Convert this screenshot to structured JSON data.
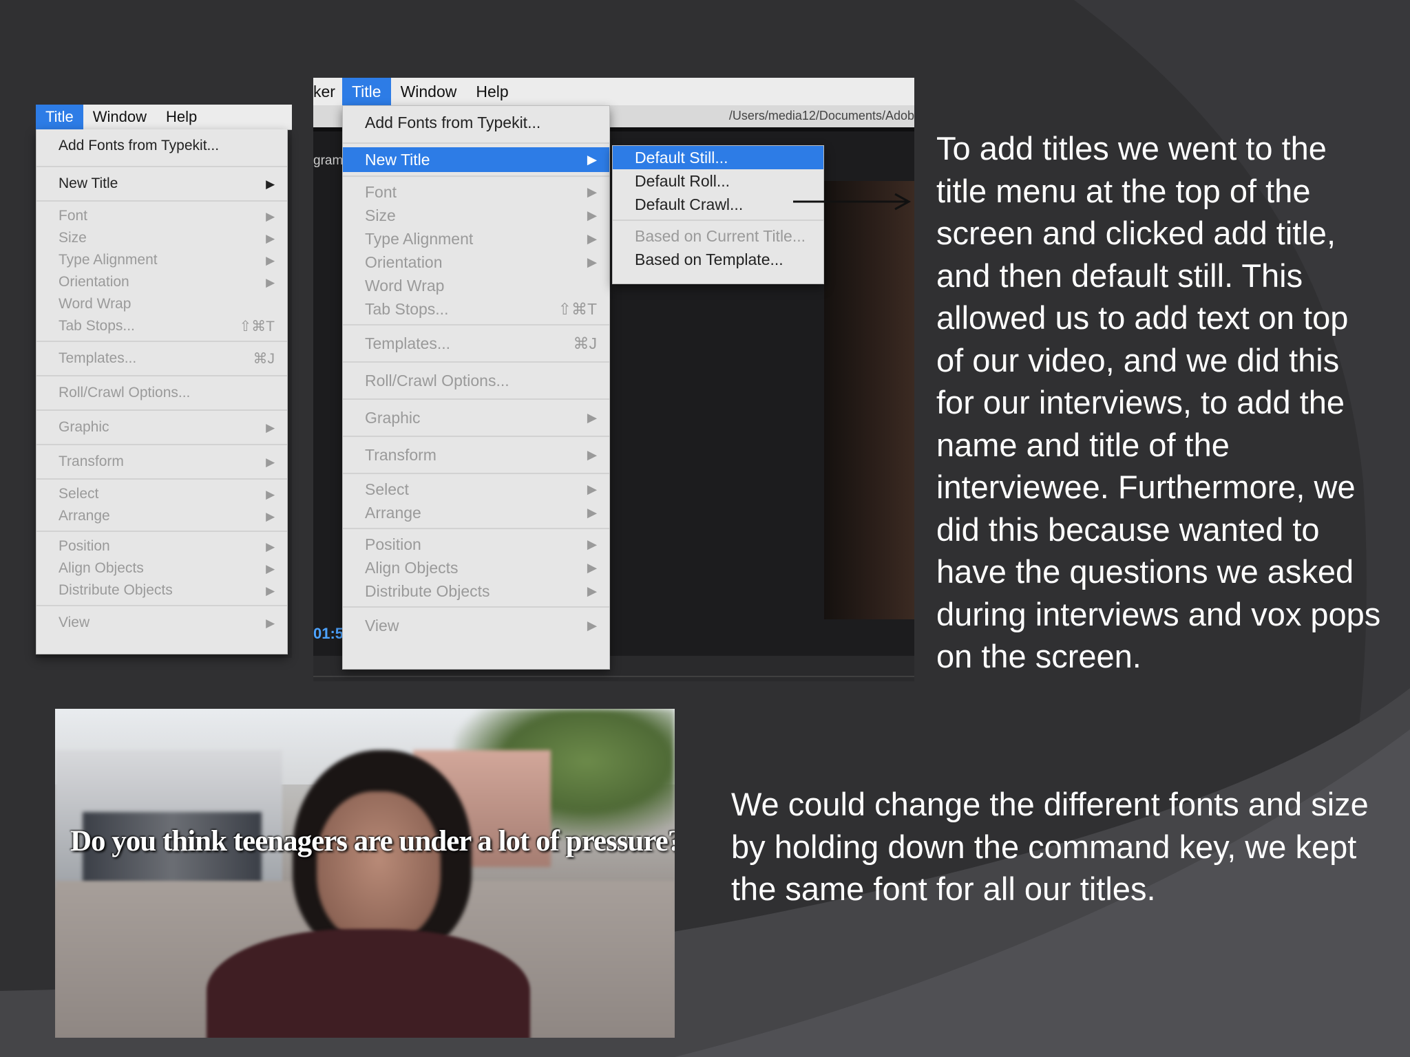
{
  "slide": {
    "paragraph_1": "To add titles we went to the title menu at the top of the screen and clicked add title, and then default still. This allowed us to add text on top of our video, and we did this for our interviews, to add the name and title of the interviewee. Furthermore, we did this because wanted to have the questions we asked during interviews and vox pops on the screen.",
    "paragraph_2": "We could change the different fonts and size by holding down the command key, we kept the same font for all our titles."
  },
  "left_screenshot": {
    "menubar": [
      "Title",
      "Window",
      "Help"
    ],
    "items": {
      "add_fonts": "Add Fonts from Typekit...",
      "new_title": "New Title",
      "font": "Font",
      "size": "Size",
      "type_alignment": "Type Alignment",
      "orientation": "Orientation",
      "word_wrap": "Word Wrap",
      "tab_stops": "Tab Stops...",
      "tab_stops_sc": "⇧⌘T",
      "templates": "Templates...",
      "templates_sc": "⌘J",
      "roll_crawl": "Roll/Crawl Options...",
      "graphic": "Graphic",
      "transform": "Transform",
      "select": "Select",
      "arrange": "Arrange",
      "position": "Position",
      "align_objects": "Align Objects",
      "distribute_objects": "Distribute Objects",
      "view": "View"
    }
  },
  "right_screenshot": {
    "menubar": [
      "ker",
      "Title",
      "Window",
      "Help"
    ],
    "path": "/Users/media12/Documents/Adob",
    "side_fragment": "gram",
    "timecode_fragment": "01:5",
    "submenu": {
      "default_still": "Default Still...",
      "default_roll": "Default Roll...",
      "default_crawl": "Default Crawl...",
      "based_on_current": "Based on Current Title...",
      "based_on_template": "Based on Template..."
    }
  },
  "video_frame": {
    "caption": "Do you think teenagers are under a lot of pressure?"
  },
  "colors": {
    "accent": "#2d7ce6",
    "background": "#303032",
    "menu": "#e6e6e6"
  }
}
